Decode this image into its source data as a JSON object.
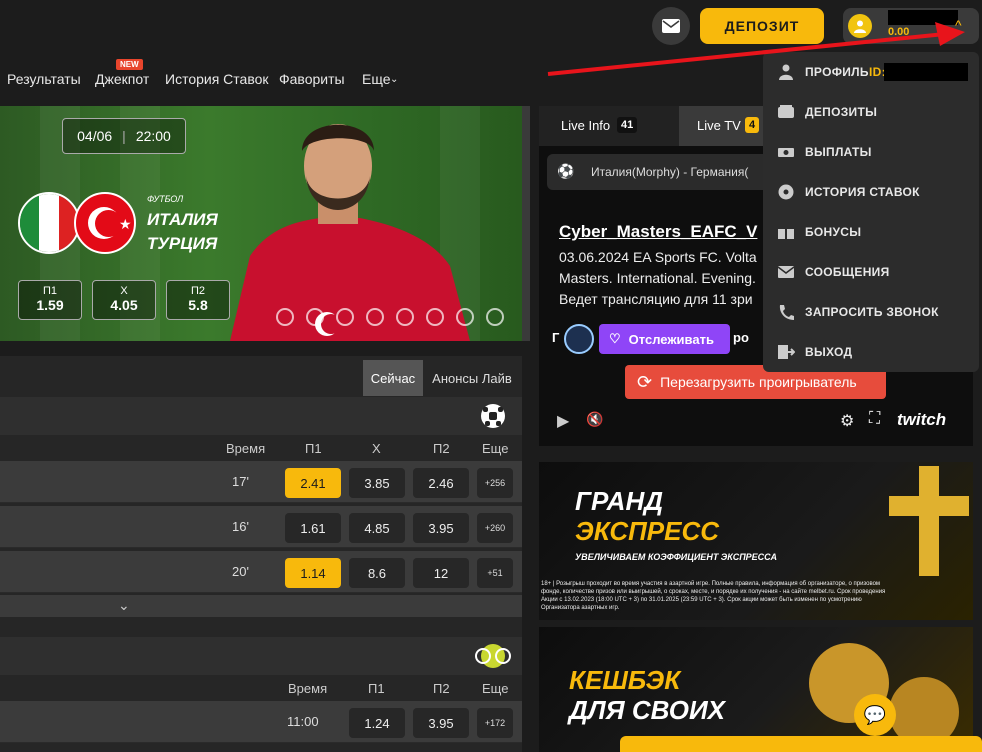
{
  "header": {
    "deposit_label": "ДЕПОЗИТ",
    "balance": "0.00"
  },
  "nav": {
    "items": [
      "Результаты",
      "Джекпот",
      "История Ставок",
      "Фавориты",
      "Еще"
    ],
    "new_badge": "NEW"
  },
  "hero": {
    "date": "04/06",
    "time": "22:00",
    "sport": "ФУТБОЛ",
    "team1": "ИТАЛИЯ",
    "team2": "ТУРЦИЯ",
    "odds": [
      {
        "label": "П1",
        "value": "1.59"
      },
      {
        "label": "X",
        "value": "4.05"
      },
      {
        "label": "П2",
        "value": "5.8"
      }
    ]
  },
  "tabs": {
    "now": "Сейчас",
    "announcements": "Анонсы Лайв"
  },
  "football": {
    "headers": {
      "time": "Время",
      "p1": "П1",
      "x": "X",
      "p2": "П2",
      "more": "Еще"
    },
    "rows": [
      {
        "time": "17'",
        "p1": "2.41",
        "x": "3.85",
        "p2": "2.46",
        "more": "+256"
      },
      {
        "time": "16'",
        "p1": "1.61",
        "x": "4.85",
        "p2": "3.95",
        "more": "+260"
      },
      {
        "time": "20'",
        "p1": "1.14",
        "x": "8.6",
        "p2": "12",
        "more": "+51"
      }
    ]
  },
  "tennis": {
    "headers": {
      "time": "Время",
      "p1": "П1",
      "p2": "П2",
      "more": "Еще"
    },
    "rows": [
      {
        "time": "11:00",
        "p1": "1.24",
        "p2": "3.95",
        "more": "+172"
      }
    ]
  },
  "live": {
    "info_label": "Live Info",
    "info_count": "41",
    "tv_label": "Live TV",
    "tv_count": "4",
    "match": "Италия(Morphy) - Германия(",
    "stream_title": "Cyber_Masters_EAFC_V",
    "stream_line1": "03.06.2024 EA Sports FC. Volta",
    "stream_line2": "Masters. International. Evening.",
    "stream_line3": "Ведет трансляцию для 11 зри",
    "channel_prefix": "Г",
    "channel_suffix": "po",
    "follow": "Отслеживать",
    "reload": "Перезагрузить проигрыватель",
    "brand": "twitch"
  },
  "menu": {
    "profile": "ПРОФИЛЬ",
    "id_label": "ID:",
    "items": [
      "ДЕПОЗИТЫ",
      "ВЫПЛАТЫ",
      "ИСТОРИЯ СТАВОК",
      "БОНУСЫ",
      "СООБЩЕНИЯ",
      "ЗАПРОСИТЬ ЗВОНОК",
      "ВЫХОД"
    ]
  },
  "banner1": {
    "line1": "ГРАНД",
    "line2": "ЭКСПРЕСС",
    "subtitle": "УВЕЛИЧИВАЕМ КОЭФФИЦИЕНТ ЭКСПРЕССА",
    "fine1": "18+ | Розыгрыш проходит во время участия в азартной игре. Полные правила, информация об организаторе, о призовом",
    "fine2": "фонде, количестве призов или выигрышей, о сроках, месте, и порядке их получения - на сайте melbet.ru. Срок проведения",
    "fine3": "Акции с 13.02.2023 (18:00 UTC + 3) по 31.01.2025 (23:59 UTC + 3). Срок акции может быть изменен по усмотрению",
    "fine4": "Организатора азартных игр."
  },
  "banner2": {
    "line1": "КЕШБЭК",
    "line2": "ДЛЯ СВОИХ"
  },
  "colors": {
    "accent": "#f8b90c",
    "purple": "#8f45f7",
    "red": "#e74c3c"
  }
}
